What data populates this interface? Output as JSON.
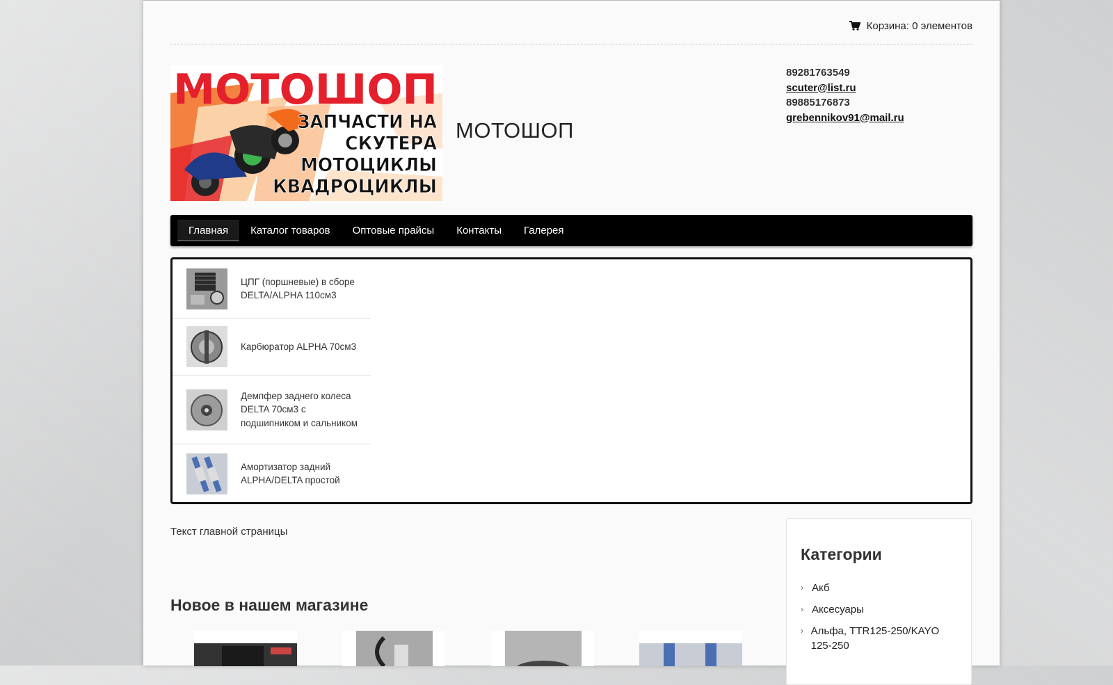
{
  "cart": {
    "label": "Корзина: 0 элементов",
    "icon": "cart-icon"
  },
  "header": {
    "logo": {
      "title": "МОТОШОП",
      "lines": [
        "ЗАПЧАСТИ НА",
        "СКУТЕРА",
        "МОТОЦИКЛЫ",
        "КВАДРОЦИКЛЫ"
      ]
    },
    "site_name": "МОТОШОП",
    "contacts": {
      "phone1": "89281763549",
      "email1": "scuter@list.ru",
      "phone2": "89885176873",
      "email2": "grebennikov91@mail.ru"
    }
  },
  "nav": {
    "items": [
      "Главная",
      "Каталог товаров",
      "Оптовые прайсы",
      "Контакты",
      "Галерея"
    ],
    "active": "Главная"
  },
  "slider": {
    "items": [
      {
        "title": "ЦПГ (поршневые) в сборе DELTA/ALPHA 110см3"
      },
      {
        "title": "Карбюратор ALPHA 70см3"
      },
      {
        "title": "Демпфер заднего колеса DELTA 70см3 с подшипником и сальником"
      },
      {
        "title": "Амортизатор задний ALPHA/DELTA простой"
      }
    ]
  },
  "main": {
    "text": "Текст главной страницы",
    "new_title": "Новое в нашем магазине"
  },
  "sidebar": {
    "title": "Категории",
    "items": [
      "Акб",
      "Аксесуары",
      "Альфа, TTR125-250/KAYO 125-250"
    ]
  },
  "colors": {
    "logo_red": "#e3202b",
    "nav_bg": "#000000",
    "accent_orange": "#f26b1d"
  }
}
